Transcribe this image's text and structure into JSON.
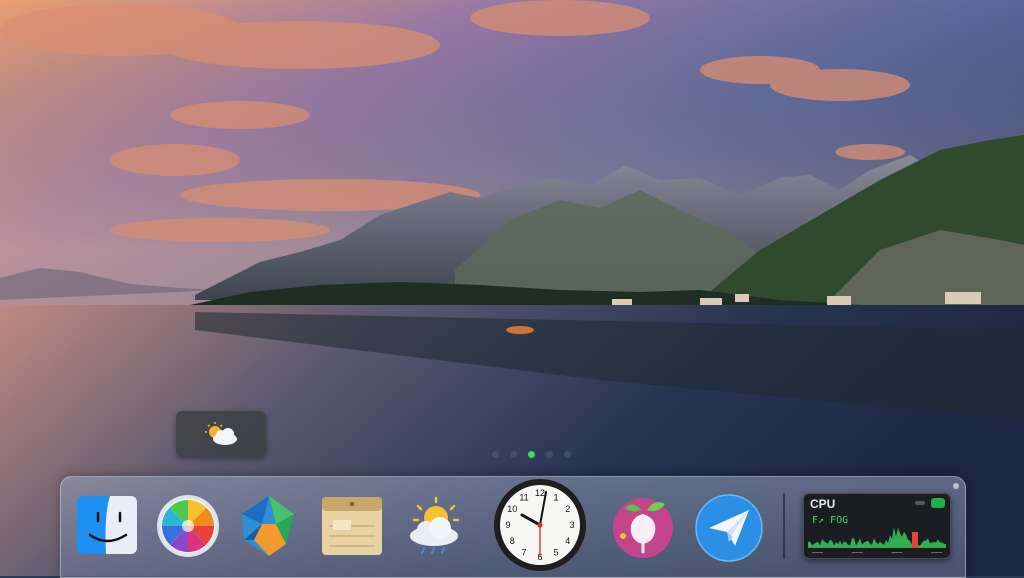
{
  "desktop": {
    "wallpaper_label": "",
    "widget": {
      "icon": "partly-cloudy-icon"
    },
    "page_dots": {
      "count": 5,
      "active_index": 3
    }
  },
  "dock": {
    "items": [
      {
        "id": "finder",
        "icon": "finder-icon"
      },
      {
        "id": "photos",
        "icon": "color-wheel-icon"
      },
      {
        "id": "app-gem",
        "icon": "gem-icon"
      },
      {
        "id": "notes",
        "icon": "notepad-icon"
      },
      {
        "id": "weather",
        "icon": "weather-icon"
      },
      {
        "id": "clock",
        "icon": "clock-icon",
        "numbers": [
          "12",
          "1",
          "2",
          "3",
          "4",
          "5",
          "6",
          "7",
          "8",
          "9",
          "10",
          "11"
        ]
      },
      {
        "id": "app-fruit",
        "icon": "fruit-icon"
      },
      {
        "id": "mail-send",
        "icon": "paper-plane-icon"
      }
    ],
    "cpu_widget": {
      "title": "CPU",
      "readout": "F↗ FOG",
      "footer": [
        "———",
        "———",
        "———",
        "———"
      ],
      "status_color": "#1fae47",
      "graph_color": "#36c95a",
      "alert_color": "#e0453a"
    }
  }
}
